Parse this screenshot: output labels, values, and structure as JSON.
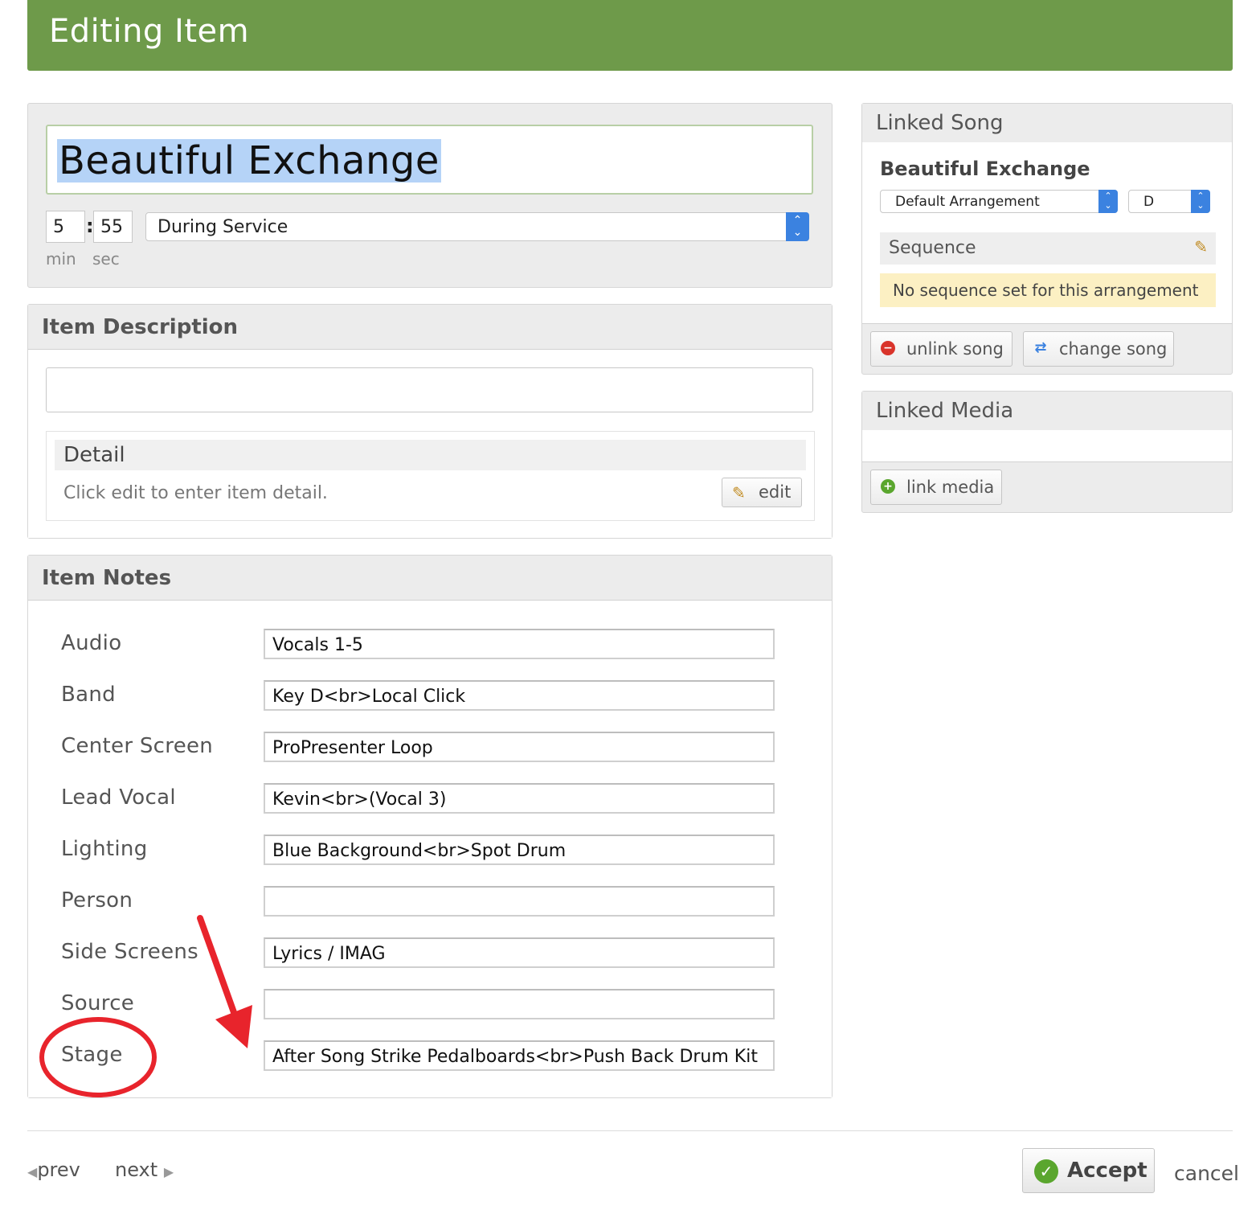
{
  "header": {
    "title": "Editing Item"
  },
  "item": {
    "title_value": "Beautiful Exchange",
    "length_min": "5",
    "length_sec": "55",
    "min_label": "min",
    "sec_label": "sec",
    "timing_select": "During Service"
  },
  "description": {
    "heading": "Item Description",
    "value": "",
    "detail_heading": "Detail",
    "detail_text": "Click edit to enter item detail.",
    "edit_label": "edit"
  },
  "notes": {
    "heading": "Item Notes",
    "rows": [
      {
        "label": "Audio",
        "value": "Vocals 1-5"
      },
      {
        "label": "Band",
        "value": "Key D<br>Local Click"
      },
      {
        "label": "Center Screen",
        "value": "ProPresenter Loop"
      },
      {
        "label": "Lead Vocal",
        "value": "Kevin<br>(Vocal 3)"
      },
      {
        "label": "Lighting",
        "value": "Blue Background<br>Spot Drum"
      },
      {
        "label": "Person",
        "value": ""
      },
      {
        "label": "Side Screens",
        "value": "Lyrics / IMAG"
      },
      {
        "label": "Source",
        "value": ""
      },
      {
        "label": "Stage",
        "value": "After Song Strike Pedalboards<br>Push Back Drum Kit"
      }
    ]
  },
  "linked_song": {
    "heading": "Linked Song",
    "song_name": "Beautiful Exchange",
    "arrangement": "Default Arrangement",
    "key": "D",
    "sequence_label": "Sequence",
    "sequence_note": "No sequence set for this arrangement",
    "unlink_label": "unlink song",
    "change_label": "change song"
  },
  "linked_media": {
    "heading": "Linked Media",
    "link_label": "link media"
  },
  "footer": {
    "prev_label": "prev",
    "next_label": "next",
    "accept_label": "Accept",
    "cancel_label": "cancel"
  },
  "colors": {
    "header": "#6e9a4a",
    "select_accent": "#3b82e0",
    "annotation": "#e8242c",
    "sequence_note_bg": "#fcf0c3",
    "accept_icon": "#5aa62e"
  }
}
